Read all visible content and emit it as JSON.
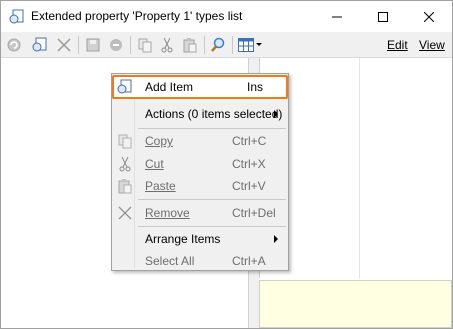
{
  "window": {
    "title": "Extended property 'Property 1' types list",
    "icon": "property-window-icon",
    "controls": {
      "minimize": "minimize-icon",
      "maximize": "maximize-icon",
      "close": "close-icon"
    }
  },
  "toolbar": {
    "buttons": [
      {
        "icon": "refresh-icon",
        "enabled": false
      },
      {
        "icon": "add-item-icon",
        "enabled": true
      },
      {
        "icon": "delete-icon",
        "enabled": false
      },
      {
        "icon": "save-icon",
        "enabled": false
      },
      {
        "icon": "cancel-icon",
        "enabled": false
      },
      {
        "icon": "copy-icon",
        "enabled": false
      },
      {
        "icon": "cut-icon",
        "enabled": false
      },
      {
        "icon": "paste-icon",
        "enabled": false
      },
      {
        "icon": "search-icon",
        "enabled": true
      },
      {
        "icon": "view-grid-icon",
        "enabled": true
      }
    ],
    "menus": {
      "edit": "Edit",
      "view": "View"
    }
  },
  "context_menu": {
    "highlight_color": "#f07a1a",
    "items": [
      {
        "label": "Add Item",
        "shortcut": "Ins",
        "icon": "add-item-icon",
        "enabled": true,
        "highlighted": true
      },
      {
        "label": "Actions (0 items selected)",
        "shortcut": "",
        "submenu": true,
        "enabled": true
      },
      {
        "label": "Copy",
        "shortcut": "Ctrl+C",
        "icon": "copy-icon",
        "enabled": false
      },
      {
        "label": "Cut",
        "shortcut": "Ctrl+X",
        "icon": "cut-icon",
        "enabled": false
      },
      {
        "label": "Paste",
        "shortcut": "Ctrl+V",
        "icon": "paste-icon",
        "enabled": false
      },
      {
        "label": "Remove",
        "shortcut": "Ctrl+Del",
        "icon": "remove-icon",
        "enabled": false
      },
      {
        "label": "Arrange Items",
        "shortcut": "",
        "submenu": true,
        "enabled": true
      },
      {
        "label": "Select All",
        "shortcut": "Ctrl+A",
        "enabled": false
      }
    ]
  },
  "colors": {
    "toolbar_bg": "#f0f0f0",
    "info_panel_bg": "#ffffe1",
    "highlight_border": "#f07a1a"
  }
}
